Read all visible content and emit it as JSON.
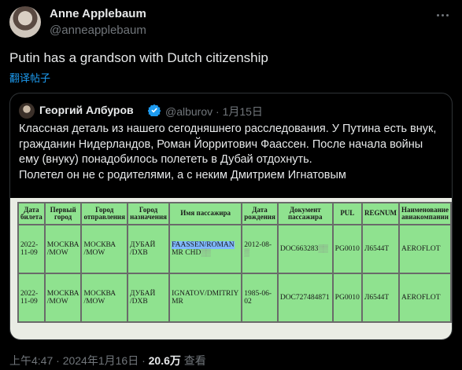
{
  "author": {
    "name": "Anne Applebaum",
    "handle": "@anneapplebaum",
    "more_icon": "more-horizontal-icon"
  },
  "tweet": {
    "text": "Putin has a grandson with Dutch citizenship",
    "translate_label": "翻译帖子"
  },
  "quote": {
    "name": "Георгий Албуров",
    "handle_date": "@alburov · 1月15日",
    "verified_color": "#1d9bf0",
    "lines": [
      "Классная деталь из нашего сегодняшнего расследования. У Путина есть внук,",
      "гражданин Нидерландов, Роман Йорритович Фаассен. После начала войны",
      "ему (внуку) понадобилось полететь в Дубай отдохнуть.",
      "Полетел он не с родителями, а с неким Дмитрием Игнатовым"
    ],
    "table": {
      "headers": [
        "Дата билета",
        "Первый город",
        "Город отправления",
        "Город назначения",
        "Имя пассажира",
        "Дата рождения",
        "Документ пассажира",
        "PUL",
        "REGNUM",
        "Наименование авиакомпании"
      ],
      "rows": [
        {
          "date": "2022-11-09",
          "first_city": "МОСКВА /MOW",
          "dep_city": "МОСКВА /MOW",
          "dest_city": "ДУБАЙ /DXB",
          "passenger_hl": "FAASSEN/ROMAN",
          "passenger_rest": "MR CHD",
          "birth": "2012-08-",
          "doc": "DOC663283",
          "pul": "PG0010",
          "regnum": "Л6544Т",
          "airline": "AEROFLOT"
        },
        {
          "date": "2022-11-09",
          "first_city": "МОСКВА /MOW",
          "dep_city": "МОСКВА /MOW",
          "dest_city": "ДУБАЙ /DXB",
          "passenger_hl": "",
          "passenger_rest": "IGNATOV/DMITRIY MR",
          "birth": "1985-06-02",
          "doc": "DOC727484871",
          "pul": "PG0010",
          "regnum": "Л6544Т",
          "airline": "AEROFLOT"
        }
      ]
    }
  },
  "meta": {
    "time_date": "上午4:47 · 2024年1月16日 · ",
    "views": "20.6万",
    "views_label": " 查看"
  }
}
